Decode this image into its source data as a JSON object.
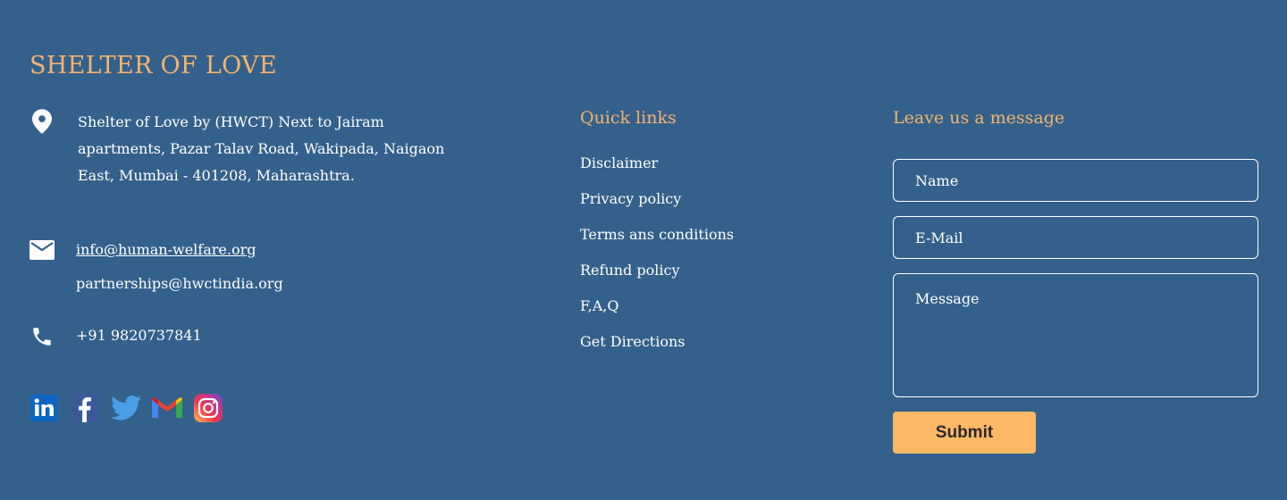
{
  "brand": "SHELTER OF LOVE",
  "contact": {
    "address": "Shelter of Love by (HWCT) Next to Jairam apartments, Pazar Talav Road, Wakipada, Naigaon East, Mumbai - 401208, Maharashtra.",
    "email_primary": "info@human-welfare.org",
    "email_secondary": "partnerships@hwctindia.org",
    "phone": "+91  9820737841"
  },
  "social": [
    "linkedin-icon",
    "facebook-icon",
    "twitter-icon",
    "gmail-icon",
    "instagram-icon"
  ],
  "quick_links": {
    "title": "Quick links",
    "items": [
      "Disclaimer",
      "Privacy policy",
      "Terms ans conditions",
      "Refund policy",
      "F,A,Q",
      "Get Directions"
    ]
  },
  "form": {
    "title": "Leave us a message",
    "name_placeholder": "Name",
    "email_placeholder": "E-Mail",
    "message_placeholder": "Message",
    "submit_label": "Submit"
  },
  "colors": {
    "background": "#34618c",
    "accent": "#f6b26b",
    "button": "#ffb866"
  }
}
